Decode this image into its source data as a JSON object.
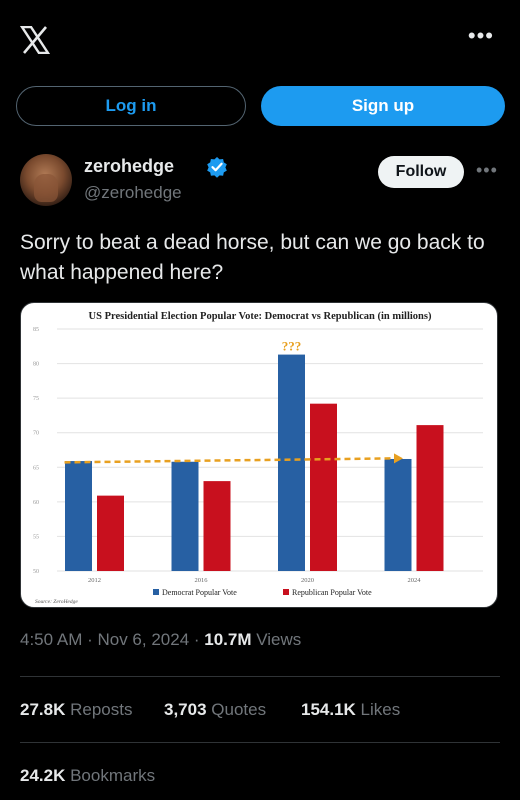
{
  "header": {
    "logo_icon": "x-logo-icon",
    "more_icon": "more-horizontal-icon",
    "more_glyph": "•••"
  },
  "auth": {
    "login_label": "Log in",
    "signup_label": "Sign up"
  },
  "post": {
    "author_name": "zerohedge",
    "author_handle": "@zerohedge",
    "follow_label": "Follow",
    "more_glyph": "•••",
    "text": "Sorry to beat a dead horse, but can we go back to what happened here?",
    "timestamp": "4:50 AM · Nov 6, 2024 · ",
    "views_count": "10.7M",
    "views_label": " Views",
    "stats": {
      "reposts_count": "27.8K",
      "reposts_label": " Reposts",
      "quotes_count": "3,703",
      "quotes_label": " Quotes",
      "likes_count": "154.1K",
      "likes_label": " Likes"
    },
    "bookmarks_count": "24.2K",
    "bookmarks_label": " Bookmarks"
  },
  "colors": {
    "accent": "#1d9bf0",
    "democrat": "#2760a3",
    "republican": "#c8101e",
    "trend": "#e8a020"
  },
  "chart_data": {
    "type": "bar",
    "title": "US Presidential Election Popular Vote: Democrat vs Republican (in millions)",
    "categories": [
      "2012",
      "2016",
      "2020",
      "2024"
    ],
    "series": [
      {
        "name": "Democrat Popular Vote",
        "values": [
          65.9,
          65.8,
          81.3,
          66.2
        ]
      },
      {
        "name": "Republican Popular Vote",
        "values": [
          60.9,
          63.0,
          74.2,
          71.1
        ]
      }
    ],
    "yticks": [
      "50",
      "55",
      "60",
      "65",
      "70",
      "75",
      "80",
      "85"
    ],
    "ylim": [
      50,
      85
    ],
    "annotation": "???",
    "source": "Source: ZeroHedge",
    "legend_position": "bottom",
    "trend_line": {
      "from_category": "2012",
      "to_category": "2024",
      "value": 66
    }
  }
}
